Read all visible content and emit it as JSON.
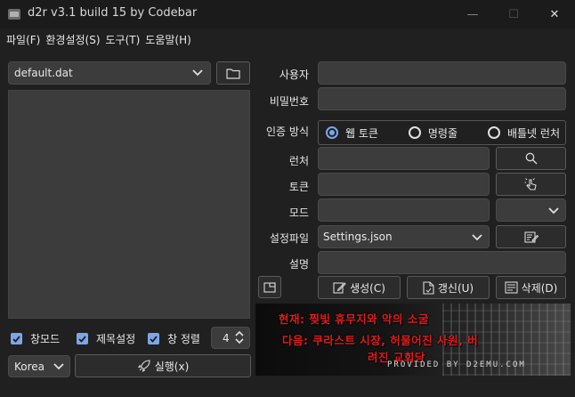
{
  "window": {
    "title": "d2r v3.1 build 15 by Codebar",
    "minimize_glyph": "—",
    "maximize_glyph": "☐",
    "close_glyph": "✕"
  },
  "menu": [
    "파일(F)",
    "환경설정(S)",
    "도구(T)",
    "도움말(H)"
  ],
  "left": {
    "file_combo_value": "default.dat",
    "checkboxes": [
      {
        "label": "창모드",
        "checked": true
      },
      {
        "label": "제목설정",
        "checked": true
      },
      {
        "label": "창 정렬",
        "checked": true
      }
    ],
    "spin_value": "4",
    "region_value": "Korea",
    "run_label": "실행(x)"
  },
  "form": {
    "user_label": "사용자",
    "password_label": "비밀번호",
    "auth_label": "인증 방식",
    "auth_options": [
      {
        "label": "웹 토큰",
        "selected": true
      },
      {
        "label": "명령줄",
        "selected": false
      },
      {
        "label": "배틀넷 런처",
        "selected": false
      }
    ],
    "launcher_label": "런처",
    "token_label": "토큰",
    "mod_label": "모드",
    "settings_label": "설정파일",
    "settings_value": "Settings.json",
    "desc_label": "설명",
    "create_label": "생성(C)",
    "update_label": "갱신(U)",
    "delete_label": "삭제(D)"
  },
  "banner": {
    "line1": "현재: 찢빛 휴무지와 악의 소굴",
    "line2": "다음: 쿠라스트 시장, 허물어진 사원, 버",
    "line3": "려진 교회당",
    "credit": "PROVIDED BY D2EMU.COM"
  },
  "colors": {
    "accent": "#7aa7e8",
    "banner_text": "#e21c1c",
    "background": "#202020",
    "field": "#3c3c3c"
  },
  "icons": [
    "app-icon",
    "folder-icon",
    "chevron-down-icon",
    "search-icon",
    "token-icon",
    "edit-icon",
    "rocket-icon",
    "window-icon",
    "create-icon",
    "update-icon",
    "delete-icon"
  ]
}
